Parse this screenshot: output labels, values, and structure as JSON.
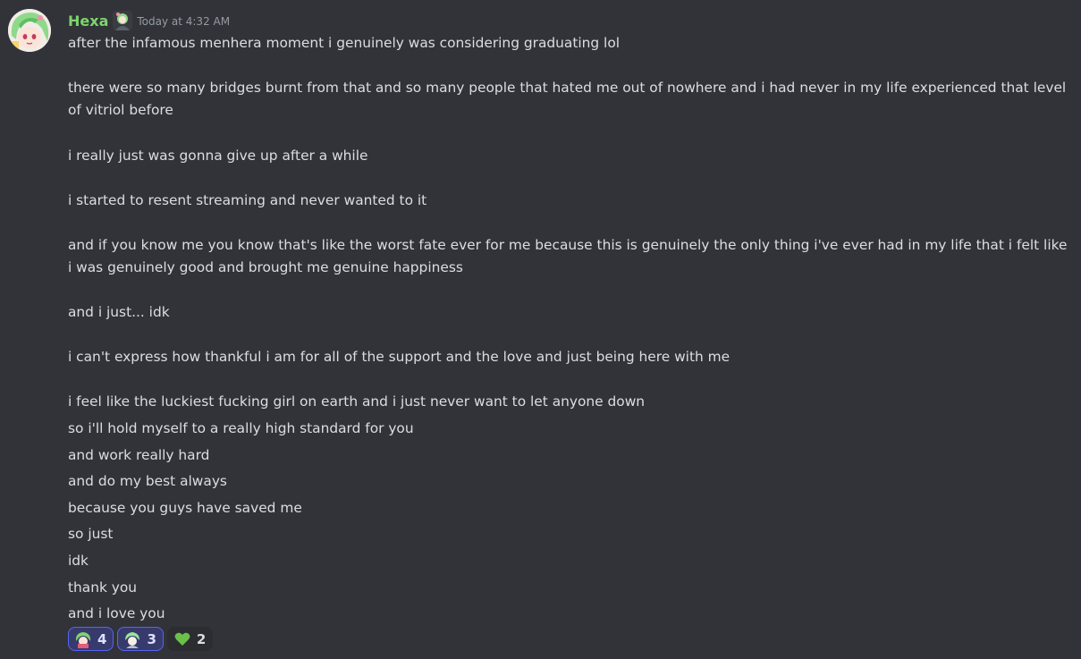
{
  "message": {
    "author": "Hexa",
    "timestamp": "Today at 4:32 AM",
    "paragraphs": [
      "after the infamous menhera moment i genuinely was considering graduating lol",
      "there were so many bridges burnt from that and so many people that hated me out of nowhere and i had never in my life experienced that level of vitriol before",
      "i really just was gonna give up after a while",
      "i started to resent streaming and never wanted to it",
      "and if you know me you know that's like the worst fate ever for me because this is genuinely the only thing i've ever had in my life that i felt like i was genuinely good and brought me genuine happiness",
      "and i just... idk",
      "i can't express how thankful i am for all of the support and the love and just being here with me",
      "i feel like the luckiest fucking girl on earth and i just never want to let anyone down",
      "so i'll hold myself to a really high standard for you",
      "and work really hard",
      "and do my best always",
      "because you guys have saved me",
      "so just",
      "idk",
      "thank you",
      "and i love you"
    ]
  },
  "reactions": [
    {
      "emoji": "custom-character-emoji",
      "count": "4",
      "me": true
    },
    {
      "emoji": "custom-character-emoji-2",
      "count": "3",
      "me": true
    },
    {
      "emoji": "green-heart",
      "count": "2",
      "me": false
    }
  ],
  "colors": {
    "background": "#313338",
    "username": "#7fd36e",
    "text": "#dbdee1",
    "timestamp": "#949ba4",
    "reaction_me_bg": "#373a6d",
    "reaction_me_border": "#5865f2",
    "heart": "#6cc04a"
  }
}
